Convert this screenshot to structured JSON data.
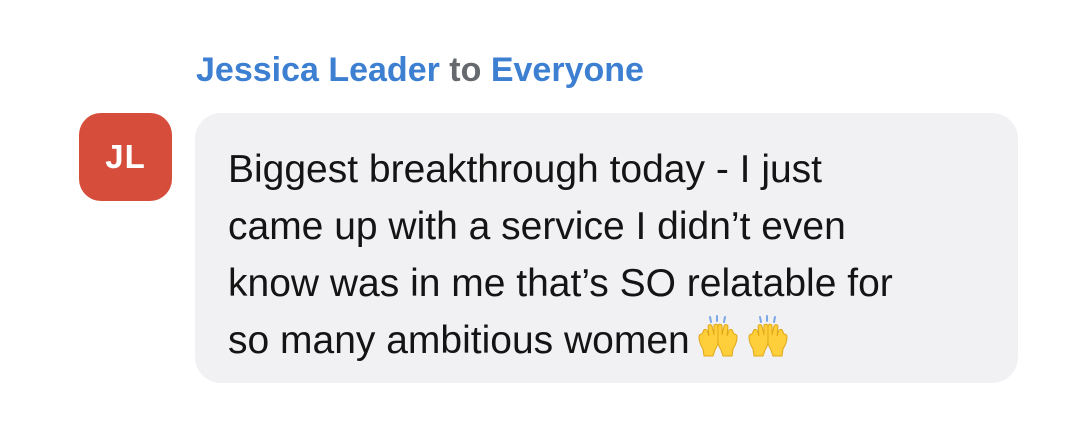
{
  "header": {
    "sender": "Jessica Leader",
    "connector": "to",
    "recipient": "Everyone"
  },
  "avatar": {
    "initials": "JL",
    "color": "#d64e3b"
  },
  "message": {
    "lines": [
      "Biggest breakthrough today - I just",
      "came up with a service I didn’t even",
      "know was in me that’s SO relatable for",
      "so many ambitious women"
    ],
    "emoji": [
      "raising-hands-icon",
      "raising-hands-icon"
    ]
  },
  "colors": {
    "name": "#3d7fd1",
    "connector": "#666a6e",
    "bubble": "#f1f1f4",
    "text": "#141414"
  }
}
